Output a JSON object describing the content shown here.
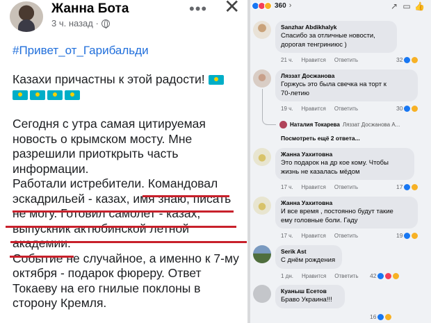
{
  "post": {
    "author": "Жанна Бота",
    "time": "3 ч. назад ·",
    "hashtag": "#Привет_от_Гарибальди",
    "lines": [
      "Казахи причастны к этой радости!",
      "Сегодня с утра самая цитируемая",
      "новость о крымском мосту. Мне",
      "разрешили приоткрыть часть",
      "информации.",
      "Работали истребители. Командовал",
      "эскадрильей - казах, имя знаю, писать",
      "не могу. Готовил самолет - казах,",
      "выпускник актюбинской летной",
      "академии.",
      "Событие не случайное, а именно к 7-му",
      "октября - подарок фюреру. Ответ",
      "Токаеву на его гнилые поклоны в",
      "сторону Кремля."
    ]
  },
  "comments_panel": {
    "reactions_count": "360",
    "comments": [
      {
        "name": "Sanzhar Abdikhalyk",
        "text": [
          "Спасибо за отличные новости,",
          "дорогая тенгриниюс )"
        ],
        "time": "21 ч.",
        "like": "Нравится",
        "reply": "Ответить",
        "count": "32"
      },
      {
        "name": "Ляззат Досжанова",
        "text": [
          "Горжусь это была свечка на торт к",
          "70-летию"
        ],
        "time": "19 ч.",
        "like": "Нравится",
        "reply": "Ответить",
        "count": "30"
      },
      {
        "name": "Жанна Уахитовна",
        "text": [
          "Это подарок на др кое кому. Чтобы",
          "жизнь не казалась мёдом"
        ],
        "time": "17 ч.",
        "like": "Нравится",
        "reply": "Ответить",
        "count": "17"
      },
      {
        "name": "Жанна Уахитовна",
        "text": [
          "И все время , постоянно будут такие",
          "ему головные боли. Гаду"
        ],
        "time": "17 ч.",
        "like": "Нравится",
        "reply": "Ответить",
        "count": "19"
      },
      {
        "name": "Serik Ast",
        "text": [
          "С днём рождения"
        ],
        "time": "1 дн.",
        "like": "Нравится",
        "reply": "Ответить",
        "count": "42"
      },
      {
        "name": "Куаныш Есетов",
        "text": [
          "Браво Украина!!!"
        ],
        "time": "",
        "like": "",
        "reply": "",
        "count": "16"
      }
    ],
    "reply_preview": {
      "name": "Наталия Токарева",
      "text": "Ляззат Досжанова А..."
    },
    "more_replies": "Посмотреть ещё 2 ответа..."
  },
  "colors": {
    "link": "#216fdb",
    "underline": "#c8202b",
    "like": "#1877f2",
    "haha": "#f7b125",
    "love": "#f33e58"
  }
}
